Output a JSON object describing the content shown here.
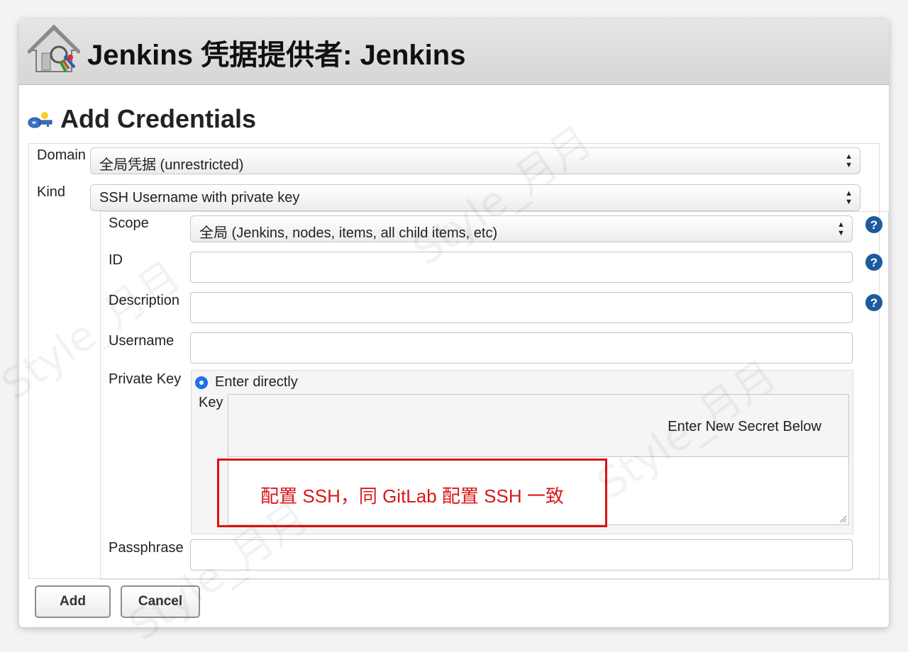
{
  "header": {
    "title": "Jenkins 凭据提供者: Jenkins",
    "icon": "jenkins-credentials-house-icon"
  },
  "section": {
    "title": "Add Credentials",
    "icon": "key-icon"
  },
  "form": {
    "domain": {
      "label": "Domain",
      "value": "全局凭据 (unrestricted)"
    },
    "kind": {
      "label": "Kind",
      "value": "SSH Username with private key"
    },
    "scope": {
      "label": "Scope",
      "value": "全局 (Jenkins, nodes, items, all child items, etc)"
    },
    "id": {
      "label": "ID",
      "value": ""
    },
    "description": {
      "label": "Description",
      "value": ""
    },
    "username": {
      "label": "Username",
      "value": ""
    },
    "private_key": {
      "label": "Private Key",
      "option": "Enter directly",
      "key_label": "Key",
      "secret_placeholder": "Enter New Secret Below",
      "value": ""
    },
    "passphrase": {
      "label": "Passphrase",
      "value": ""
    }
  },
  "annotation": {
    "text": "配置 SSH，同 GitLab 配置 SSH 一致",
    "color": "#e01010"
  },
  "buttons": {
    "add": "Add",
    "cancel": "Cancel"
  },
  "watermark": "Style_月月",
  "colors": {
    "accent": "#1a73e8",
    "help": "#1d5a9e",
    "annotation": "#e01010"
  }
}
